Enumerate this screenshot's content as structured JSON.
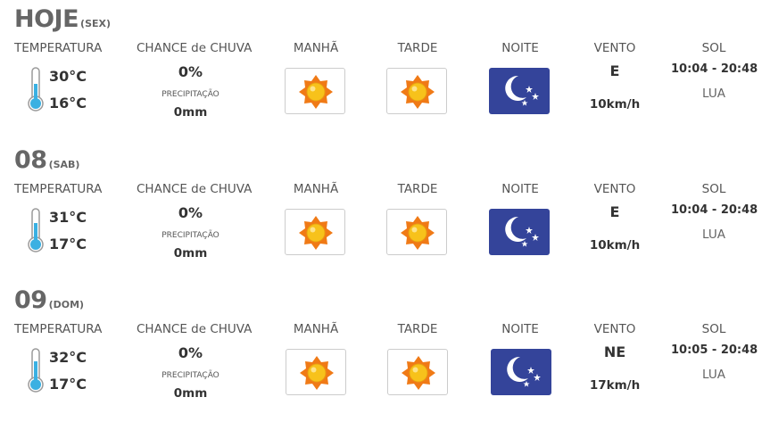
{
  "columns": {
    "temperature": "TEMPERATURA",
    "rain_chance": "CHANCE de CHUVA",
    "morning": "MANHÃ",
    "afternoon": "TARDE",
    "night": "NOITE",
    "wind": "VENTO",
    "sun": "SOL"
  },
  "labels": {
    "precipitation": "PRECIPITAÇÃO",
    "moon": "LUA"
  },
  "days": [
    {
      "day": "HOJE",
      "weekday": "(SEX)",
      "temp_max": "30°C",
      "temp_min": "16°C",
      "rain_chance": "0%",
      "precipitation": "0mm",
      "morning_icon": "sun-icon",
      "afternoon_icon": "sun-icon",
      "night_icon": "moon-stars-icon",
      "wind_dir": "E",
      "wind_speed": "10km/h",
      "sun_times": "10:04 - 20:48"
    },
    {
      "day": "08",
      "weekday": "(SAB)",
      "temp_max": "31°C",
      "temp_min": "17°C",
      "rain_chance": "0%",
      "precipitation": "0mm",
      "morning_icon": "sun-icon",
      "afternoon_icon": "sun-icon",
      "night_icon": "moon-stars-icon",
      "wind_dir": "E",
      "wind_speed": "10km/h",
      "sun_times": "10:04 - 20:48"
    },
    {
      "day": "09",
      "weekday": "(DOM)",
      "temp_max": "32°C",
      "temp_min": "17°C",
      "rain_chance": "0%",
      "precipitation": "0mm",
      "morning_icon": "sun-icon",
      "afternoon_icon": "sun-icon",
      "night_icon": "moon-stars-icon",
      "wind_dir": "NE",
      "wind_speed": "17km/h",
      "sun_times": "10:05 - 20:48"
    }
  ],
  "colors": {
    "thermometer": "#3ab0e2",
    "sun_outer": "#f07a16",
    "sun_inner": "#f7c21b",
    "night_bg": "#34449a"
  }
}
